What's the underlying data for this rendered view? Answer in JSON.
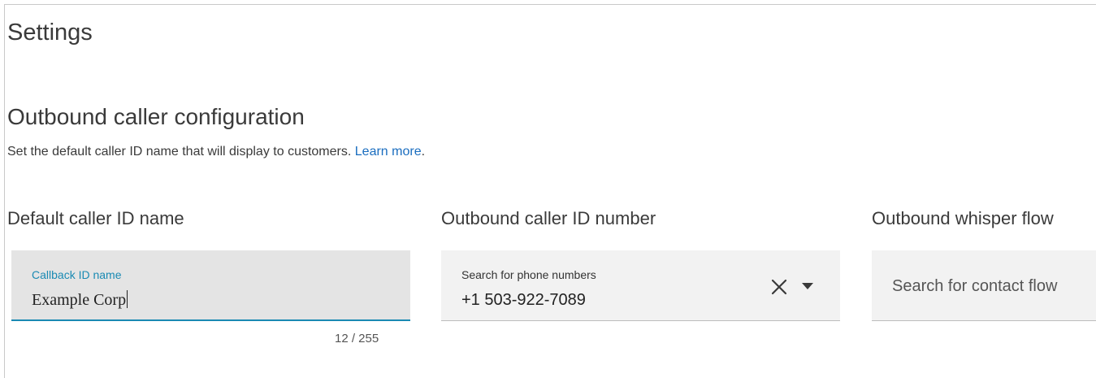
{
  "page": {
    "title": "Settings"
  },
  "section": {
    "title": "Outbound caller configuration",
    "description": "Set the default caller ID name that will display to customers.",
    "learn_more": "Learn more",
    "period": "."
  },
  "columns": {
    "default_name_label": "Default caller ID name",
    "outbound_number_label": "Outbound caller ID number",
    "whisper_flow_label": "Outbound whisper flow"
  },
  "name_field": {
    "float_label": "Callback ID name",
    "value": "Example Corp",
    "counter": "12 / 255"
  },
  "phone_field": {
    "float_label": "Search for phone numbers",
    "value": "+1 503-922-7089",
    "clear_icon": "close-icon",
    "dropdown_icon": "caret-down-icon"
  },
  "flow_field": {
    "placeholder": "Search for contact flow"
  },
  "colors": {
    "accent": "#1a8ab3",
    "link": "#1a6dbf",
    "text": "#333333"
  }
}
